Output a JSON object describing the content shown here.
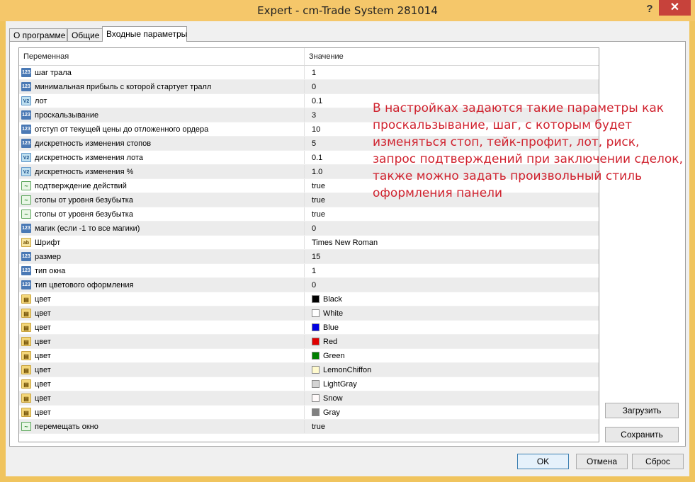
{
  "window": {
    "title": "Expert - cm-Trade System 281014",
    "help": "?",
    "close": "✕"
  },
  "tabs": [
    {
      "label": "О программе"
    },
    {
      "label": "Общие"
    },
    {
      "label": "Входные параметры"
    }
  ],
  "grid": {
    "columns": {
      "name": "Переменная",
      "value": "Значение"
    },
    "rows": [
      {
        "icon": "123",
        "name": "шаг трала",
        "value": "1"
      },
      {
        "icon": "123",
        "name": "минимальная прибыль с которой стартует тралл",
        "value": "0"
      },
      {
        "icon": "V2",
        "name": "лот",
        "value": "0.1"
      },
      {
        "icon": "123",
        "name": "проскальзывание",
        "value": "3"
      },
      {
        "icon": "123",
        "name": "отступ от текущей цены до отложенного ордера",
        "value": "10"
      },
      {
        "icon": "123",
        "name": "дискретность изменения стопов",
        "value": "5"
      },
      {
        "icon": "V2",
        "name": "дискретность изменения лота",
        "value": "0.1"
      },
      {
        "icon": "V2",
        "name": "дискретность изменения %",
        "value": "1.0"
      },
      {
        "icon": "~",
        "name": "подтверждение действий",
        "value": "true"
      },
      {
        "icon": "~",
        "name": "стопы от уровня безубытка",
        "value": "true"
      },
      {
        "icon": "~",
        "name": "стопы от уровня безубытка",
        "value": "true"
      },
      {
        "icon": "123",
        "name": "магик (если -1 то все магики)",
        "value": "0"
      },
      {
        "icon": "ab",
        "name": "Шрифт",
        "value": "Times New Roman"
      },
      {
        "icon": "123",
        "name": "размер",
        "value": "15"
      },
      {
        "icon": "123",
        "name": "тип окна",
        "value": "1"
      },
      {
        "icon": "123",
        "name": "тип цветового оформления",
        "value": "0"
      },
      {
        "icon": "▤",
        "name": "цвет",
        "value": "Black",
        "swatch": "#000000"
      },
      {
        "icon": "▤",
        "name": "цвет",
        "value": "White",
        "swatch": "#ffffff"
      },
      {
        "icon": "▤",
        "name": "цвет",
        "value": "Blue",
        "swatch": "#0000e0"
      },
      {
        "icon": "▤",
        "name": "цвет",
        "value": "Red",
        "swatch": "#e00000"
      },
      {
        "icon": "▤",
        "name": "цвет",
        "value": "Green",
        "swatch": "#008000"
      },
      {
        "icon": "▤",
        "name": "цвет",
        "value": "LemonChiffon",
        "swatch": "#fffacd"
      },
      {
        "icon": "▤",
        "name": "цвет",
        "value": "LightGray",
        "swatch": "#d3d3d3"
      },
      {
        "icon": "▤",
        "name": "цвет",
        "value": "Snow",
        "swatch": "#fffafa"
      },
      {
        "icon": "▤",
        "name": "цвет",
        "value": "Gray",
        "swatch": "#808080"
      },
      {
        "icon": "~",
        "name": "перемещать окно",
        "value": "true"
      }
    ]
  },
  "annotation": {
    "lines": [
      "В настройках задаются такие параметры как",
      "проскальзывание, шаг, с которым будет",
      "изменяться стоп, тейк-профит, лот, риск,",
      "запрос подтверждений при заключении сделок,",
      "также можно задать произвольный стиль",
      "оформления панели"
    ]
  },
  "buttons": {
    "load": "Загрузить",
    "save": "Сохранить",
    "ok": "OK",
    "cancel": "Отмена",
    "reset": "Сброс"
  }
}
